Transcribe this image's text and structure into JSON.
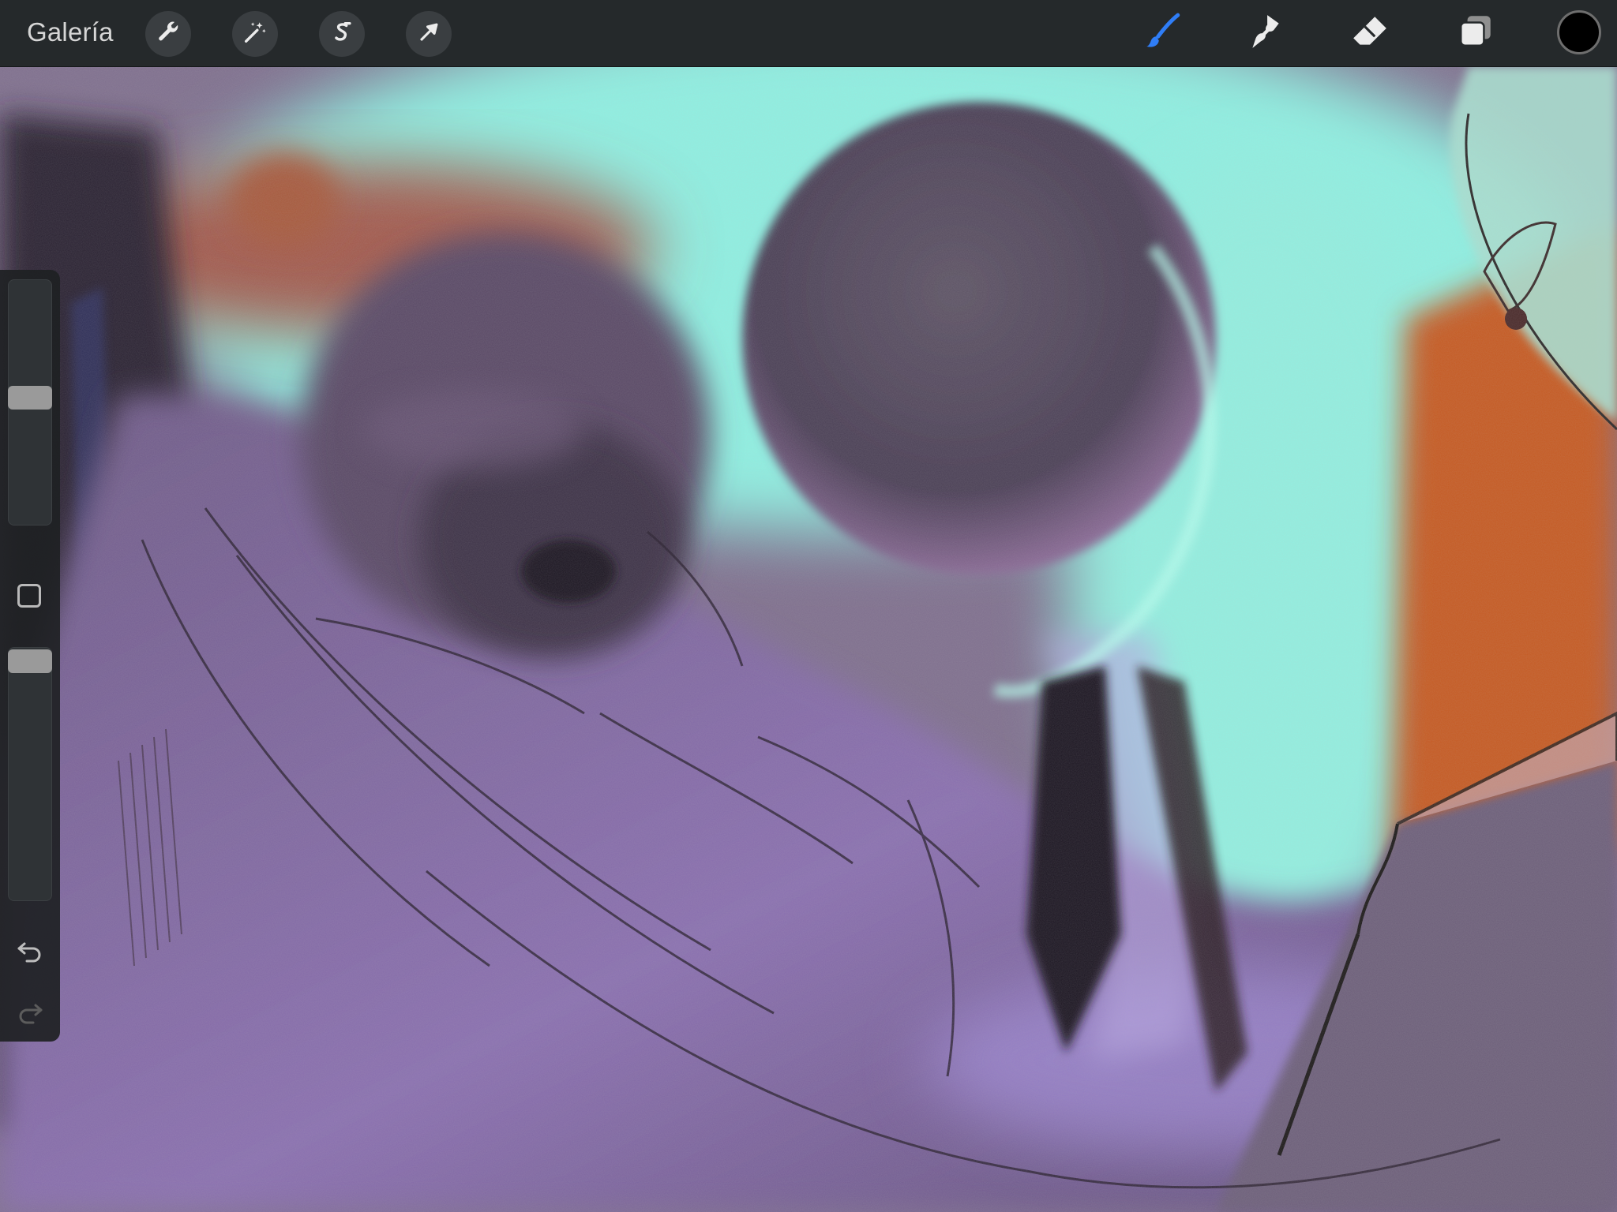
{
  "toolbar": {
    "gallery_label": "Galería",
    "actions": [
      {
        "name": "wrench-icon"
      },
      {
        "name": "magic-wand-icon"
      },
      {
        "name": "selection-s-icon"
      },
      {
        "name": "transform-arrow-icon"
      }
    ],
    "paint_tools": [
      {
        "name": "brush-icon",
        "active": true
      },
      {
        "name": "smudge-icon",
        "active": false
      },
      {
        "name": "eraser-icon",
        "active": false
      },
      {
        "name": "layers-icon",
        "active": false
      }
    ],
    "active_tool_color": "#2f7df6",
    "current_color": "#000000"
  },
  "sidebar": {
    "brush_size_level": 0.52,
    "opacity_level": 0.99,
    "buttons": [
      "modify-button",
      "undo-icon",
      "redo-icon"
    ]
  },
  "canvas": {
    "palette": {
      "sky": "#8ff0e2",
      "purple_fog": "#7d6494",
      "orange": "#c65a24",
      "dark": "#2b2230"
    }
  }
}
